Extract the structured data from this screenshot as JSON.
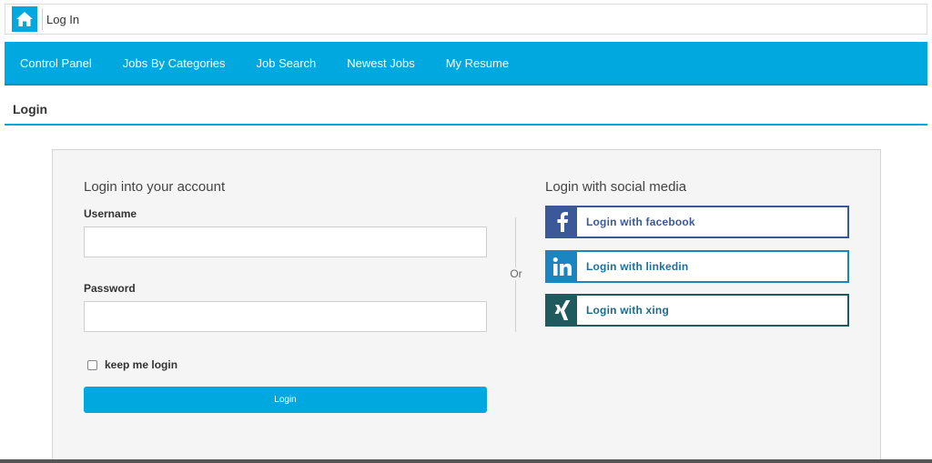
{
  "breadcrumb": {
    "current": "Log In",
    "home_icon": "home-icon"
  },
  "nav": {
    "items": [
      {
        "label": "Control Panel"
      },
      {
        "label": "Jobs By Categories"
      },
      {
        "label": "Job Search"
      },
      {
        "label": "Newest Jobs"
      },
      {
        "label": "My Resume"
      }
    ]
  },
  "page": {
    "title": "Login"
  },
  "login_form": {
    "heading": "Login into your account",
    "username_label": "Username",
    "username_value": "",
    "password_label": "Password",
    "password_value": "",
    "remember_label": "keep me login",
    "submit_label": "Login"
  },
  "separator": {
    "text": "Or"
  },
  "social": {
    "heading": "Login with social media",
    "buttons": [
      {
        "label": "Login with facebook",
        "icon": "facebook-icon",
        "color": "#3b5999"
      },
      {
        "label": "Login with linkedin",
        "icon": "linkedin-icon",
        "color": "#1b85c2"
      },
      {
        "label": "Login with xing",
        "icon": "xing-icon",
        "color": "#1f5b5e"
      }
    ]
  },
  "colors": {
    "accent": "#00a8e0"
  }
}
